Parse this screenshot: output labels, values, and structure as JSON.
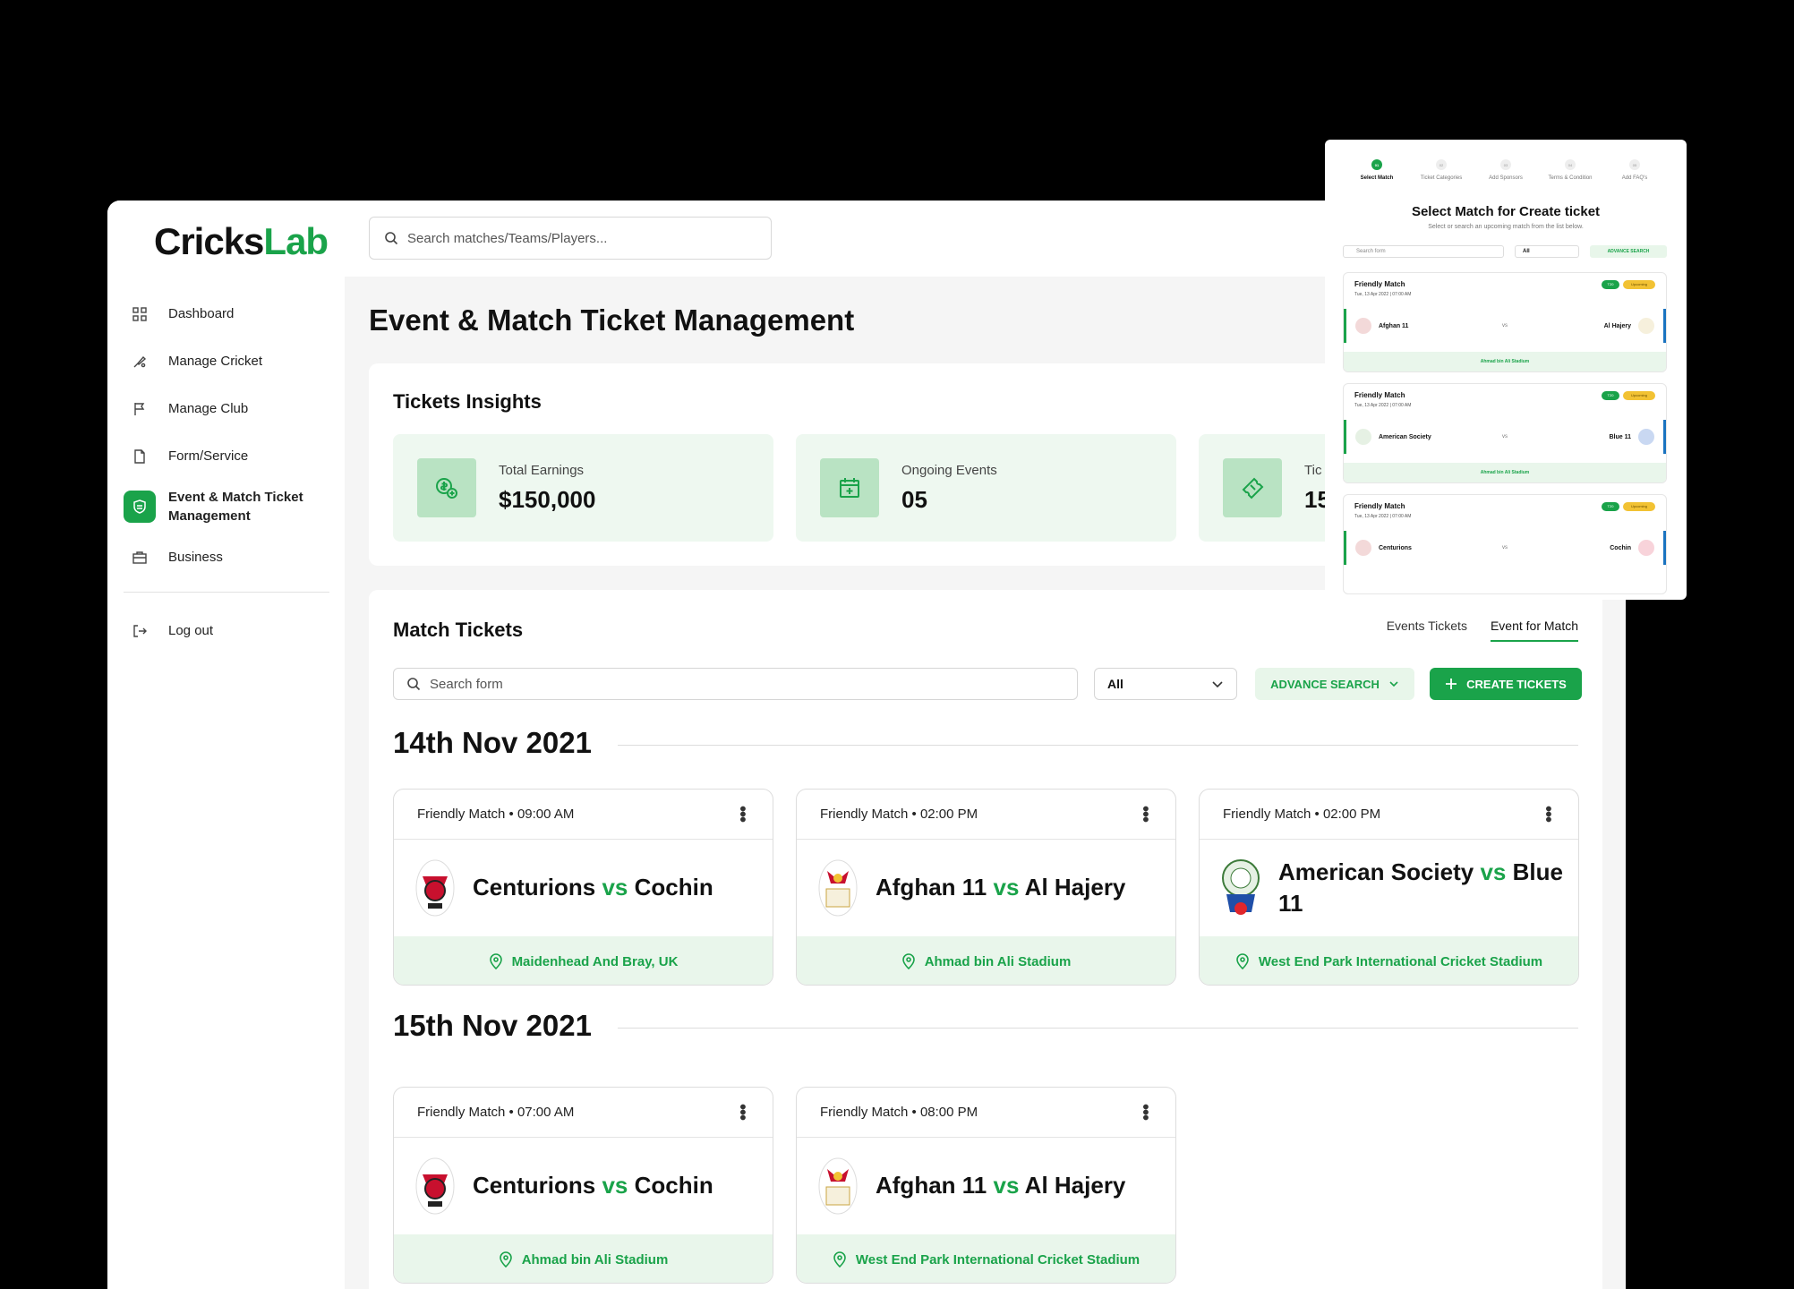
{
  "brand": {
    "name_part1": "Cricks",
    "name_part2": "Lab"
  },
  "topbar": {
    "search_placeholder": "Search matches/Teams/Players..."
  },
  "sidebar": {
    "items": [
      {
        "label": "Dashboard",
        "icon": "grid-icon"
      },
      {
        "label": "Manage Cricket",
        "icon": "bat-icon"
      },
      {
        "label": "Manage Club",
        "icon": "flag-icon"
      },
      {
        "label": "Form/Service",
        "icon": "document-icon"
      },
      {
        "label": "Event & Match Ticket Management",
        "icon": "ticket-shield-icon",
        "active": true
      },
      {
        "label": "Business",
        "icon": "briefcase-icon"
      }
    ],
    "logout_label": "Log out"
  },
  "page": {
    "title": "Event & Match Ticket Management"
  },
  "insights": {
    "title": "Tickets Insights",
    "stats": [
      {
        "label": "Total Earnings",
        "value": "$150,000"
      },
      {
        "label": "Ongoing Events",
        "value": "05"
      },
      {
        "label": "Tic",
        "value": "15"
      }
    ]
  },
  "match_tickets": {
    "title": "Match Tickets",
    "tabs": [
      "Events Tickets",
      "Event for Match"
    ],
    "active_tab": "Event for Match",
    "search_placeholder": "Search form",
    "filter_value": "All",
    "advance_search_label": "ADVANCE SEARCH",
    "create_label": "CREATE TICKETS",
    "groups": [
      {
        "date": "14th Nov 2021",
        "cards": [
          {
            "header": "Friendly Match • 09:00 AM",
            "team1": "Centurions",
            "vs": "vs",
            "team2": "Cochin",
            "venue": "Maidenhead And Bray, UK"
          },
          {
            "header": "Friendly Match • 02:00 PM",
            "team1": "Afghan 11",
            "vs": "vs",
            "team2": "Al Hajery",
            "venue": "Ahmad bin Ali Stadium"
          },
          {
            "header": "Friendly Match • 02:00 PM",
            "team1": "American Society",
            "vs": "vs",
            "team2": "Blue 11",
            "venue": "West End Park International Cricket Stadium"
          }
        ]
      },
      {
        "date": "15th Nov 2021",
        "cards": [
          {
            "header": "Friendly Match • 07:00 AM",
            "team1": "Centurions",
            "vs": "vs",
            "team2": "Cochin",
            "venue": "Ahmad bin Ali Stadium"
          },
          {
            "header": "Friendly Match • 08:00 PM",
            "team1": "Afghan 11",
            "vs": "vs",
            "team2": "Al Hajery",
            "venue": "West End Park International Cricket Stadium"
          }
        ]
      }
    ]
  },
  "popup": {
    "steps": [
      "Select Match",
      "Ticket Categories",
      "Add Sponsors",
      "Terms & Condition",
      "Add FAQ's"
    ],
    "step_numbers": [
      "01",
      "02",
      "03",
      "04",
      "05"
    ],
    "title": "Select Match for Create ticket",
    "subtitle": "Select or search an upcoming match from the list below.",
    "search_placeholder": "Search form",
    "filter_value": "All",
    "advance_search_label": "ADVANCE SEARCH",
    "cards": [
      {
        "type": "Friendly Match",
        "date": "Tue, 13 Apr 2022 | 07:00 AM",
        "badge1": "T20",
        "badge2": "Upcoming",
        "team1": "Afghan 11",
        "vs": "vs",
        "team2": "Al Hajery",
        "venue": "Ahmad bin Ali Stadium"
      },
      {
        "type": "Friendly Match",
        "date": "Tue, 13 Apr 2022 | 07:00 AM",
        "badge1": "T20",
        "badge2": "Upcoming",
        "team1": "American Society",
        "vs": "vs",
        "team2": "Blue 11",
        "venue": "Ahmad bin Ali Stadium"
      },
      {
        "type": "Friendly Match",
        "date": "Tue, 13 Apr 2022 | 07:00 AM",
        "badge1": "T20",
        "badge2": "Upcoming",
        "team1": "Centurions",
        "vs": "vs",
        "team2": "Cochin",
        "venue": ""
      }
    ]
  },
  "colors": {
    "accent": "#1aa34a",
    "accent_soft": "#e9f6eb",
    "ball": "#e0262c"
  }
}
